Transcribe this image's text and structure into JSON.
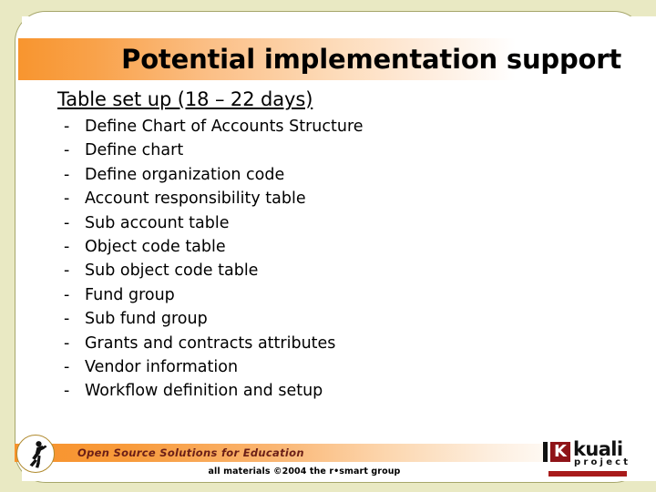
{
  "slide": {
    "title": "Potential implementation support",
    "section_heading": "Table set up (18 – 22 days)",
    "bullet_marker": "-",
    "bullets": [
      "Define Chart of Accounts Structure",
      "Define chart",
      "Define organization code",
      "Account responsibility table",
      "Sub account table",
      "Object code table",
      "Sub object code table",
      "Fund group",
      "Sub fund group",
      "Grants and contracts attributes",
      "Vendor information",
      "Workflow definition and setup"
    ]
  },
  "footer": {
    "tagline": "Open Source Solutions for Education",
    "copyright": "all materials ©2004 the r•smart group",
    "logo": {
      "mark_letter": "K",
      "word": "kuali",
      "sub": "project"
    },
    "runner_icon": "runner-icon"
  },
  "colors": {
    "background": "#e9e9c3",
    "card": "#ffffff",
    "card_border": "#a6a66a",
    "accent_orange": "#f8952f",
    "tagline_text": "#6b1f17",
    "logo_red": "#8f1418",
    "logo_rule_red": "#a81b1b",
    "body_text": "#000000"
  }
}
